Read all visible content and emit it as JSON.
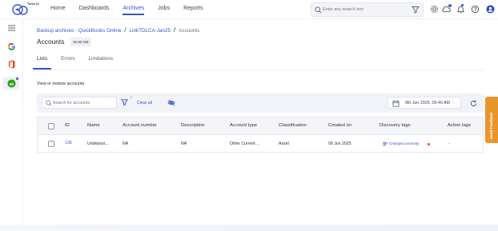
{
  "app": {
    "logo_text": "Turbo UI"
  },
  "nav": {
    "items": [
      "Home",
      "Dashboards",
      "Archives",
      "Jobs",
      "Reports"
    ],
    "active": "Archives"
  },
  "search": {
    "placeholder": "Enter any search text"
  },
  "notifications": {
    "cloud_badge": "N"
  },
  "breadcrumb": {
    "root": "Backup archives - QuickBooks Online",
    "archive": "LinkTDLCA-Jan25",
    "current": "Accounts"
  },
  "page": {
    "title": "Accounts",
    "size": "36.85 MB"
  },
  "tabs": [
    "Lists",
    "Errors",
    "Limitations"
  ],
  "section": {
    "title": "View or restore accounts"
  },
  "toolbar": {
    "search_placeholder": "Search for accounts",
    "filter_count": "1",
    "clear_all": "Clear all",
    "date": "9th Jun 2025, 05:40 AM"
  },
  "table": {
    "columns": [
      "ID",
      "Name",
      "Account number",
      "Description",
      "Account type",
      "Classification",
      "Created on",
      "Discovery tags",
      "Action tags"
    ],
    "rows": [
      {
        "id": "136",
        "name": "Undeposi...",
        "account_number": "NA",
        "description": "NA",
        "account_type": "Other Current ...",
        "classification": "Asset",
        "created_on": "09 Jun 2025",
        "discovery_tag": "Changed anomaly",
        "action_tags": "-"
      }
    ]
  },
  "feedback": {
    "label": "Send Feedback"
  },
  "colors": {
    "accent": "#3a54c4",
    "feedback": "#e8962c",
    "anomaly_dot": "#e2463d"
  }
}
